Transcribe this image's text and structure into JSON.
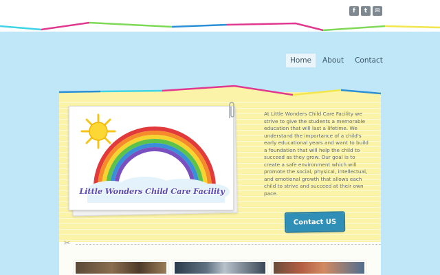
{
  "social": {
    "facebook_icon": "f",
    "twitter_icon": "t",
    "email_icon": "✉"
  },
  "nav": {
    "items": [
      {
        "label": "Home",
        "active": true
      },
      {
        "label": "About",
        "active": false
      },
      {
        "label": "Contact",
        "active": false
      }
    ]
  },
  "logo": {
    "text": "Little Wonders Child Care Facility"
  },
  "intro": {
    "text": "At Little Wonders Child Care Facility we strive to give the students a memorable education that will last a lifetime.   We understand the importance of a child's early educational years and want to build a foundation that will help the child to succeed as they grow.  Our goal is to create a safe environment which will promote the social, physical, intellectual, and emotional growth that allows each child to strive and succeed at their own pace."
  },
  "cta": {
    "label": "Contact US"
  },
  "colors": {
    "sky": "#bfe7f7",
    "paper": "#fbf3a8",
    "button": "#2f8fb6",
    "wave_pink": "#e0388f",
    "wave_green": "#7ed957",
    "wave_blue": "#2b8fd6",
    "wave_cyan": "#3fd3e6"
  }
}
